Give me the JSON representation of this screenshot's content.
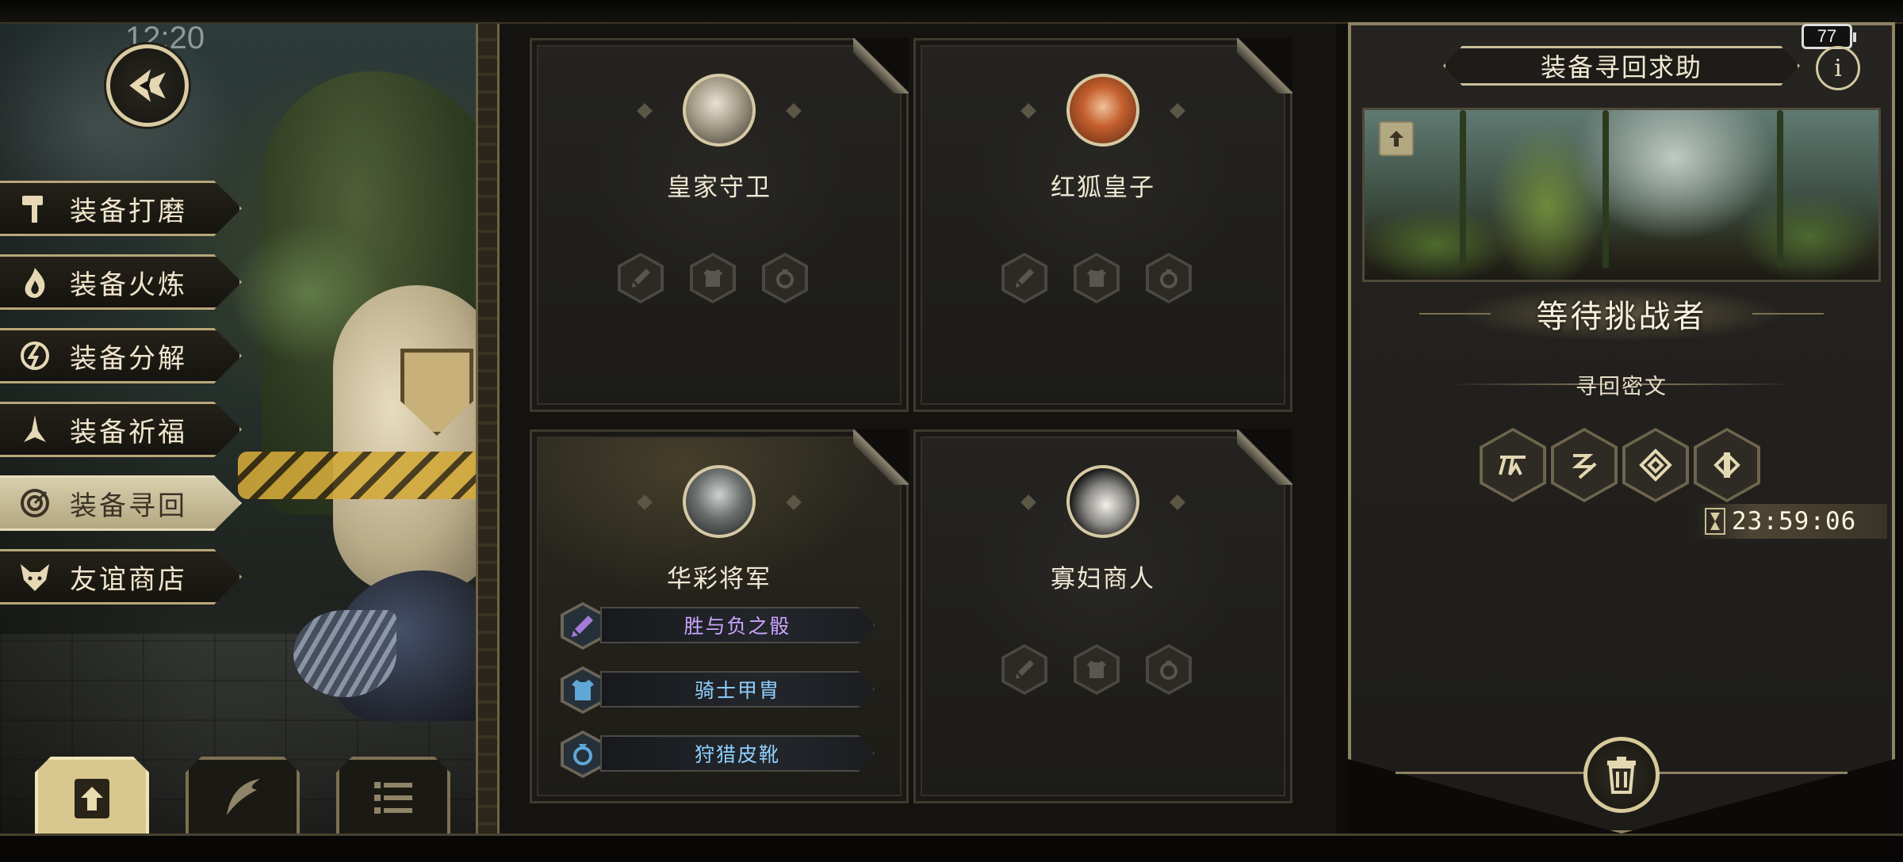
{
  "status_bar": {
    "time": "12:20",
    "battery": "77"
  },
  "nav": {
    "back_icon": "back-arrow-icon",
    "menu": [
      {
        "label": "装备打磨",
        "icon": "hammer-icon",
        "active": false
      },
      {
        "label": "装备火炼",
        "icon": "flame-icon",
        "active": false
      },
      {
        "label": "装备分解",
        "icon": "decompose-icon",
        "active": false
      },
      {
        "label": "装备祈福",
        "icon": "pray-icon",
        "active": false
      },
      {
        "label": "装备寻回",
        "icon": "retrieve-icon",
        "active": true
      },
      {
        "label": "友谊商店",
        "icon": "fox-icon",
        "active": false
      }
    ],
    "bottom_tabs": [
      {
        "icon": "upload-icon",
        "active": true
      },
      {
        "icon": "quill-icon",
        "active": false
      },
      {
        "icon": "list-icon",
        "active": false
      }
    ]
  },
  "challengers": [
    {
      "name": "皇家守卫",
      "portrait": "royal-guard",
      "equipped": false,
      "slots": [
        "sword-icon",
        "armor-icon",
        "ring-icon"
      ]
    },
    {
      "name": "红狐皇子",
      "portrait": "red-fox-prince",
      "equipped": false,
      "slots": [
        "sword-icon",
        "armor-icon",
        "ring-icon"
      ]
    },
    {
      "name": "华彩将军",
      "portrait": "splendid-general",
      "equipped": true,
      "items": [
        {
          "name": "胜与负之骰",
          "icon": "sword-icon",
          "color": "#c9a4ff"
        },
        {
          "name": "骑士甲胄",
          "icon": "armor-icon",
          "color": "#8fd0ff"
        },
        {
          "name": "狩猎皮靴",
          "icon": "ring-icon",
          "color": "#8fd0ff"
        }
      ]
    },
    {
      "name": "寡妇商人",
      "portrait": "widow-merchant",
      "equipped": false,
      "slots": [
        "sword-icon",
        "armor-icon",
        "ring-icon"
      ]
    }
  ],
  "help_panel": {
    "title": "装备寻回求助",
    "info": "i",
    "status": "等待挑战者",
    "runes_label": "寻回密文",
    "runes": [
      "rune-1-icon",
      "rune-2-icon",
      "rune-3-icon",
      "rune-4-icon"
    ],
    "timer": "23:59:06",
    "action_icon": "trash-icon"
  },
  "colors": {
    "accent": "#cbbf98",
    "rare_purple": "#c9a4ff",
    "rare_blue": "#8fd0ff",
    "panel": "#1e1d1a"
  }
}
